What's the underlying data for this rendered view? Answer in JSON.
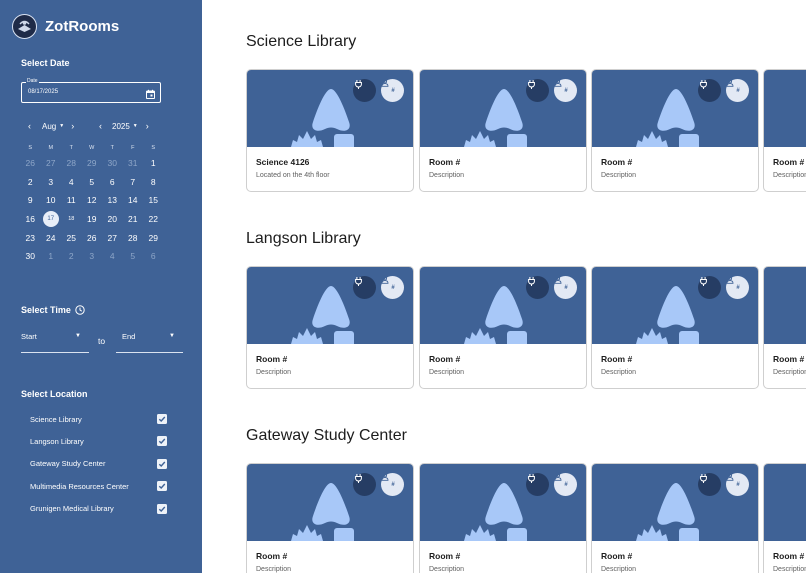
{
  "app": {
    "name": "ZotRooms"
  },
  "sidebar": {
    "date_section": {
      "title": "Select Date",
      "field_label": "Date",
      "field_value": "08/17/2025"
    },
    "calendar": {
      "month": "Aug",
      "year": "2025",
      "weekdays": [
        "S",
        "M",
        "T",
        "W",
        "T",
        "F",
        "S"
      ],
      "weeks": [
        [
          "26",
          "27",
          "28",
          "29",
          "30",
          "31",
          "1"
        ],
        [
          "2",
          "3",
          "4",
          "5",
          "6",
          "7",
          "8"
        ],
        [
          "9",
          "10",
          "11",
          "12",
          "13",
          "14",
          "15"
        ],
        [
          "16",
          "17",
          "18",
          "19",
          "20",
          "21",
          "22"
        ],
        [
          "23",
          "24",
          "25",
          "26",
          "27",
          "28",
          "29"
        ],
        [
          "30",
          "1",
          "2",
          "3",
          "4",
          "5",
          "6"
        ]
      ],
      "selected_day": "17"
    },
    "time_section": {
      "title": "Select Time",
      "start_placeholder": "Start",
      "separator": "to",
      "end_placeholder": "End"
    },
    "location_section": {
      "title": "Select Location",
      "locations": [
        {
          "label": "Science Library",
          "checked": true
        },
        {
          "label": "Langson Library",
          "checked": true
        },
        {
          "label": "Gateway Study Center",
          "checked": true
        },
        {
          "label": "Multimedia Resources Center",
          "checked": true
        },
        {
          "label": "Grunigen Medical Library",
          "checked": true
        }
      ]
    }
  },
  "libraries": [
    {
      "name": "Science Library",
      "rooms": [
        {
          "title": "Science 4126",
          "description": "Located on the 4th floor",
          "capacity": "#"
        },
        {
          "title": "Room #",
          "description": "Description",
          "capacity": "#"
        },
        {
          "title": "Room #",
          "description": "Description",
          "capacity": "#"
        },
        {
          "title": "Room #",
          "description": "Description",
          "capacity": "#"
        }
      ]
    },
    {
      "name": "Langson Library",
      "rooms": [
        {
          "title": "Room #",
          "description": "Description",
          "capacity": "#"
        },
        {
          "title": "Room #",
          "description": "Description",
          "capacity": "#"
        },
        {
          "title": "Room #",
          "description": "Description",
          "capacity": "#"
        },
        {
          "title": "Room #",
          "description": "Description",
          "capacity": "#"
        }
      ]
    },
    {
      "name": "Gateway Study Center",
      "rooms": [
        {
          "title": "Room #",
          "description": "Description",
          "capacity": "#"
        },
        {
          "title": "Room #",
          "description": "Description",
          "capacity": "#"
        },
        {
          "title": "Room #",
          "description": "Description",
          "capacity": "#"
        },
        {
          "title": "Room #",
          "description": "Description",
          "capacity": "#"
        }
      ]
    }
  ],
  "colors": {
    "sidebar_bg": "#3f6296",
    "card_image_bg": "#3f6296",
    "placeholder_shape": "#a8c8f8",
    "plug_button_bg": "#263d64",
    "capacity_button_bg": "#e3e9f4"
  },
  "icons": {
    "calendar": "calendar-icon",
    "clock": "clock-icon",
    "power": "power-plug-icon",
    "capacity": "person-capacity-icon",
    "checkbox": "checkmark-icon"
  }
}
